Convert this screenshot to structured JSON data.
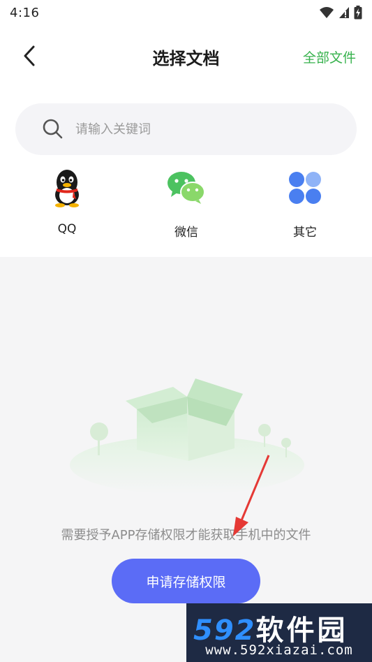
{
  "status_bar": {
    "time": "4:16"
  },
  "nav": {
    "title": "选择文档",
    "action_label": "全部文件"
  },
  "search": {
    "placeholder": "请输入关键词"
  },
  "sources": [
    {
      "label": "QQ",
      "icon": "qq-penguin-icon"
    },
    {
      "label": "微信",
      "icon": "wechat-icon"
    },
    {
      "label": "其它",
      "icon": "other-apps-icon"
    }
  ],
  "empty_state": {
    "tip": "需要授予APP存储权限才能获取手机中的文件",
    "button_label": "申请存储权限"
  },
  "watermark": {
    "logo_num": "592",
    "logo_cn": "软件园",
    "url": "www.592xiazai.com"
  },
  "colors": {
    "accent_green": "#37b24d",
    "button_blue": "#5b6cf6",
    "arrow_red": "#e53935"
  }
}
